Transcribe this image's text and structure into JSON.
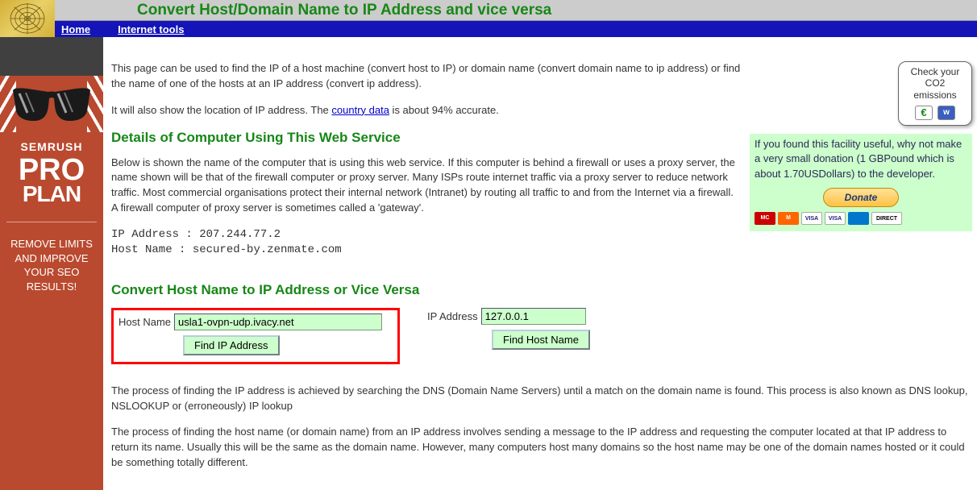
{
  "header": {
    "title": "Convert Host/Domain Name to IP Address and vice versa",
    "nav": {
      "home": "Home",
      "tools": "Internet tools"
    }
  },
  "sidebar_ad": {
    "brand": "SEMRUSH",
    "pro": "PRO",
    "plan": "PLAN",
    "tagline": "REMOVE LIMITS AND IMPROVE YOUR SEO RESULTS!"
  },
  "intro": {
    "p1": "This page can be used to find the IP of a host machine (convert host to IP) or domain name (convert domain name to ip address) or find the name of one of the hosts at an IP address (convert ip address).",
    "p2_prefix": "It will also show the location of IP address. The ",
    "p2_link": "country data",
    "p2_suffix": " is about 94% accurate."
  },
  "right": {
    "co2_line1": "Check your",
    "co2_line2": "CO2",
    "co2_line3": "emissions",
    "donate_text": "If you found this facility useful, why not make a very small donation (1 GBPound which is about 1.70USDollars) to the developer.",
    "donate_btn": "Donate"
  },
  "details": {
    "heading": "Details of Computer Using This Web Service",
    "para": "Below is shown the name of the computer that is using this web service. If this computer is behind a firewall or uses a proxy server, the name shown will be that of the firewall computer or proxy server. Many ISPs route internet traffic via a proxy server to reduce network traffic. Most commercial organisations protect their internal network (Intranet) by routing all traffic to and from the Internet via a firewall. A firewall computer of proxy server is sometimes called a 'gateway'.",
    "ip_label": "IP Address : ",
    "ip_value": "207.244.77.2",
    "host_label": "Host Name  : ",
    "host_value": "secured-by.zenmate.com"
  },
  "convert": {
    "heading": "Convert Host Name to IP Address or Vice Versa",
    "hostname_label": "Host Name",
    "hostname_value": "usla1-ovpn-udp.ivacy.net",
    "find_ip_btn": "Find IP Address",
    "ip_label": "IP Address",
    "ip_value": "127.0.0.1",
    "find_host_btn": "Find Host Name"
  },
  "explain": {
    "p1": "The process of finding the IP address is achieved by searching the DNS (Domain Name Servers) until a match on the domain name is found. This process is also known as DNS lookup, NSLOOKUP or (erroneously) IP lookup",
    "p2": "The process of finding the host name (or domain name) from an IP address involves sending a message to the IP address and requesting the computer located at that IP address to return its name. Usually this will be the same as the domain name. However, many computers host many domains so the host name may be one of the domain names hosted or it could be something totally different."
  }
}
